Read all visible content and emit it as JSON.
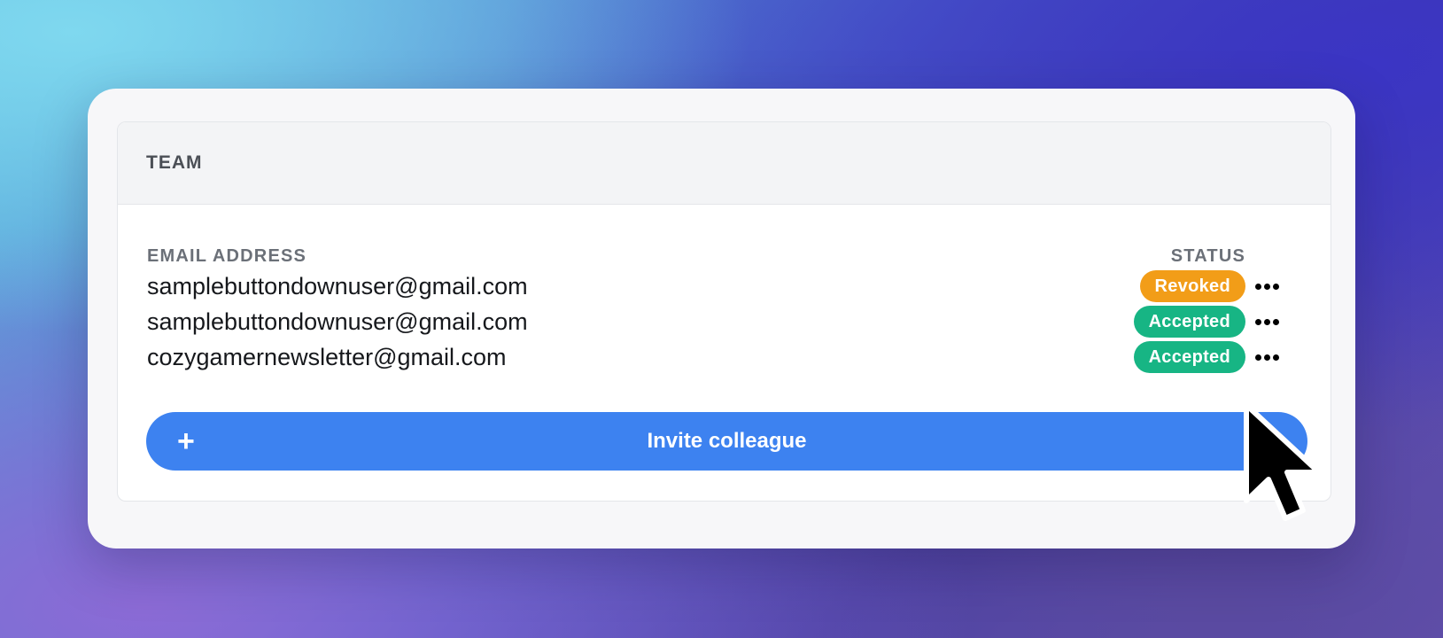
{
  "team_panel": {
    "title": "TEAM",
    "columns": {
      "email": "EMAIL ADDRESS",
      "status": "STATUS"
    },
    "members": [
      {
        "email": "samplebuttondownuser@gmail.com",
        "status": "Revoked",
        "status_color": "#f29d18"
      },
      {
        "email": "samplebuttondownuser@gmail.com",
        "status": "Accepted",
        "status_color": "#17b584"
      },
      {
        "email": "cozygamernewsletter@gmail.com",
        "status": "Accepted",
        "status_color": "#17b584"
      }
    ],
    "more_icon": "more-horizontal-icon",
    "invite_button": {
      "icon": "plus-icon",
      "icon_glyph": "+",
      "label": "Invite colleague",
      "color": "#3d82f0"
    }
  },
  "cursor": {
    "icon": "arrow-cursor-icon"
  }
}
